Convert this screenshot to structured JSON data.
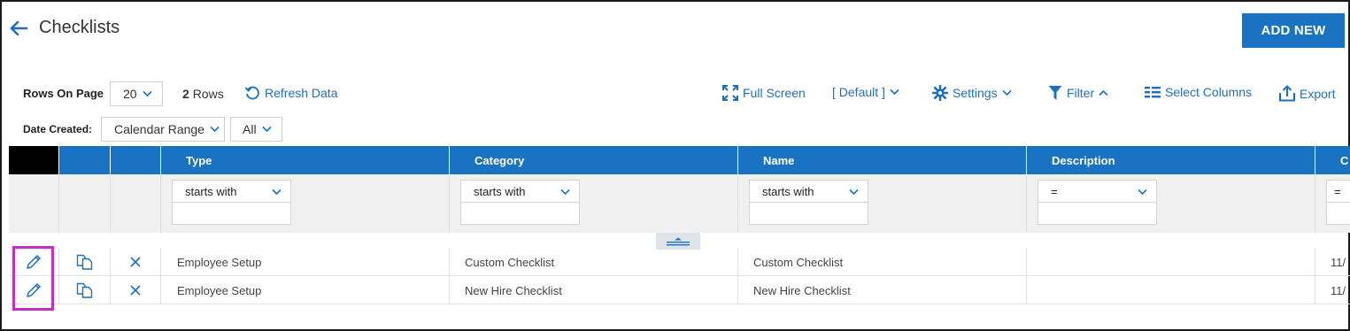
{
  "header": {
    "title": "Checklists",
    "add_new_label": "ADD NEW"
  },
  "toolbar": {
    "rows_on_page_label": "Rows On Page",
    "rows_on_page_value": "20",
    "row_count": "2",
    "rows_label": "Rows",
    "refresh_label": "Refresh Data",
    "full_screen_label": "Full Screen",
    "view_label": "[ Default ]",
    "settings_label": "Settings",
    "filter_label": "Filter",
    "select_columns_label": "Select Columns",
    "export_label": "Export"
  },
  "date_filter": {
    "label": "Date Created:",
    "range_value": "Calendar Range",
    "all_value": "All"
  },
  "grid": {
    "columns": [
      "Type",
      "Category",
      "Name",
      "Description",
      "C"
    ],
    "filters": [
      "starts with",
      "starts with",
      "starts with",
      "=",
      "="
    ],
    "rows": [
      {
        "type": "Employee Setup",
        "category": "Custom Checklist",
        "name": "Custom Checklist",
        "description": "",
        "c": "11/"
      },
      {
        "type": "Employee Setup",
        "category": "New Hire Checklist",
        "name": "New Hire Checklist",
        "description": "",
        "c": "11/"
      }
    ]
  },
  "colors": {
    "accent": "#1a72c2",
    "highlight": "#c42ec4"
  },
  "icons": [
    "back-arrow-icon",
    "refresh-icon",
    "fullscreen-icon",
    "chevron-down-icon",
    "gear-icon",
    "filter-icon",
    "columns-icon",
    "export-icon",
    "pencil-icon",
    "copy-icon",
    "delete-icon"
  ]
}
